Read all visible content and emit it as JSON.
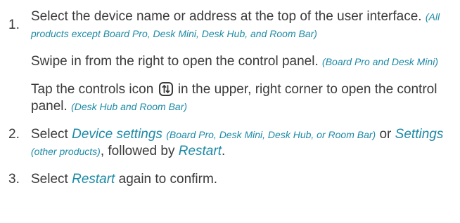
{
  "steps": [
    {
      "number": "1.",
      "p1_text": "Select the device name or address at the top of the user interface.",
      "p1_note": "(All products except Board Pro, Desk Mini, Desk Hub, and Room Bar)",
      "p2_text": "Swipe in from the right to open the control panel.",
      "p2_note": "(Board Pro and Desk Mini)",
      "p3_text_before": "Tap the controls icon",
      "p3_icon": "controls-icon",
      "p3_text_after": "in the upper, right corner to open the control panel.",
      "p3_note": "(Desk Hub and Room Bar)"
    },
    {
      "number": "2.",
      "text_select": "Select",
      "term_device_settings": "Device settings",
      "note_device_settings": "(Board Pro, Desk Mini, Desk Hub, or Room Bar)",
      "text_or": "or",
      "term_settings": "Settings",
      "note_settings": "(other products)",
      "text_followed": ", followed by",
      "term_restart": "Restart",
      "text_period": "."
    },
    {
      "number": "3.",
      "text_select": "Select",
      "term_restart": "Restart",
      "text_after": "again to confirm."
    }
  ],
  "colors": {
    "body_text": "#3a3a3a",
    "accent": "#1d8aa6"
  }
}
